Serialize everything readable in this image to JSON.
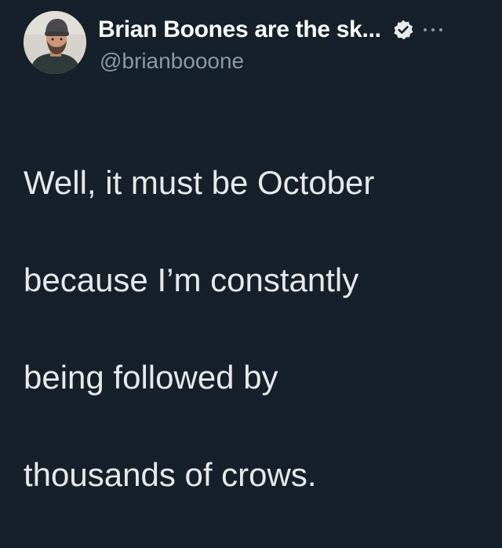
{
  "tweet": {
    "author": {
      "display_name": "Brian Boones are the sk...",
      "handle": "@brianbooone",
      "verified_icon": "verified-badge-icon",
      "avatar": "profile-photo"
    },
    "more_icon": "more-options-icon",
    "text_lines": [
      "Well, it must be October",
      "because I’m constantly",
      "being followed by",
      "thousands of crows."
    ]
  },
  "colors": {
    "background": "#15202b",
    "text": "#e7e9ea",
    "secondary_text": "#8b98a5",
    "verified_badge": "#e7e9ea"
  }
}
